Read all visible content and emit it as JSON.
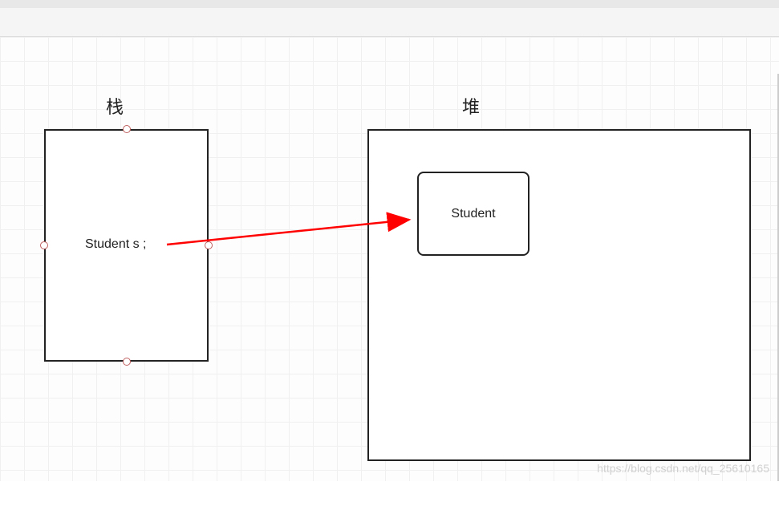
{
  "labels": {
    "stack": "栈",
    "heap": "堆"
  },
  "stack": {
    "variable": "Student s ;"
  },
  "heap": {
    "object": "Student"
  },
  "arrow": {
    "from": "stack-variable",
    "to": "heap-object",
    "color": "#ff0000"
  },
  "watermark": "https://blog.csdn.net/qq_25610165"
}
